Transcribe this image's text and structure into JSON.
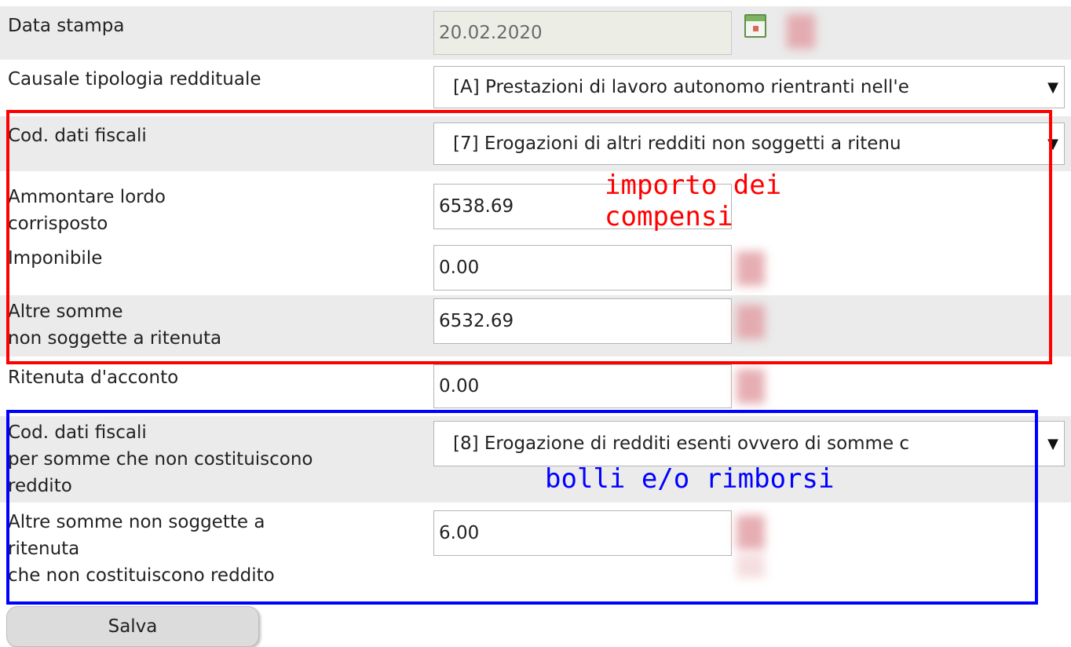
{
  "fields": {
    "data_stampa": {
      "label": "Data stampa",
      "value": "20.02.2020"
    },
    "causale": {
      "label": "Causale tipologia reddituale",
      "value": "[A] Prestazioni di lavoro autonomo rientranti nell'e"
    },
    "cod_dati_fiscali": {
      "label": "Cod. dati fiscali",
      "value": "[7] Erogazioni di altri redditi non soggetti a ritenu"
    },
    "ammontare": {
      "label": "Ammontare lordo\ncorrisposto",
      "value": "6538.69"
    },
    "imponibile": {
      "label": "Imponibile",
      "value": "0.00"
    },
    "altre_somme": {
      "label": "Altre somme\nnon soggette a ritenuta",
      "value": "6532.69"
    },
    "ritenuta": {
      "label": "Ritenuta d'acconto",
      "value": "0.00"
    },
    "cod_dati_fiscali_nr": {
      "label": "Cod. dati fiscali\nper somme che non costituiscono\nreddito",
      "value": "[8] Erogazione di redditi esenti ovvero di somme c"
    },
    "altre_somme_nr": {
      "label": "Altre somme non soggette a\nritenuta\nche non costituiscono reddito",
      "value": "6.00"
    }
  },
  "save_button": "Salva",
  "annotations": {
    "red": {
      "text": "importo dei\ncompensi",
      "color": "#ff0000"
    },
    "blue": {
      "text": "bolli e/o rimborsi",
      "color": "#0000ff"
    }
  },
  "icons": {
    "calendar": "calendar-icon",
    "dropdown": "▼"
  }
}
